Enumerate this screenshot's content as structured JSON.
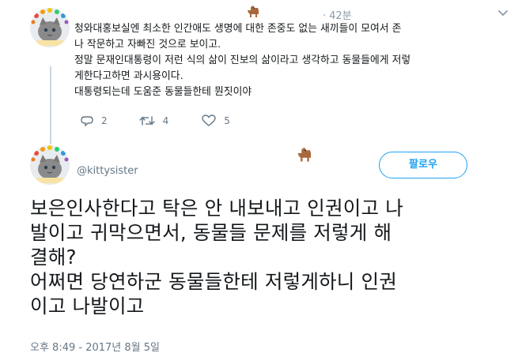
{
  "reply": {
    "emoji": "🐕",
    "time": "42분",
    "time_prefix": "·",
    "lines": [
      "청와대홍보실엔 최소한 인간애도 생명에 대한 존중도 없는 새끼들이 모여서 존",
      "나 작문하고 자빠진 것으로 보이고.",
      "정말 문재인대통령이 저런 식의 삶이 진보의 삶이라고 생각하고 동물들에게 저렇",
      "게한다고하면 과시용이다.",
      "대통령되는데 도움준 동물들한테 뭔짓이야"
    ],
    "actions": {
      "reply_count": "2",
      "retweet_count": "4",
      "like_count": "5"
    }
  },
  "tweet": {
    "emoji": "🐕",
    "handle": "@kittysister",
    "follow_label": "팔로우",
    "lines": [
      "보은인사한다고 탁은 안 내보내고 인권이고 나",
      "발이고 귀막으면서, 동물들 문제를 저렇게 해",
      "결해?",
      "어쩌면 당연하군 동물들한테 저렇게하니 인권",
      "이고 나발이고"
    ],
    "timestamp": "오후 8:49 - 2017년 8월 5일"
  },
  "icons": {
    "reply": "reply-icon",
    "retweet": "retweet-icon",
    "like": "heart-icon",
    "more": "chevron-down-icon"
  },
  "colors": {
    "accent": "#1da1f2",
    "muted": "#657786",
    "text": "#14171a",
    "thread_line": "#ccd6dd"
  }
}
